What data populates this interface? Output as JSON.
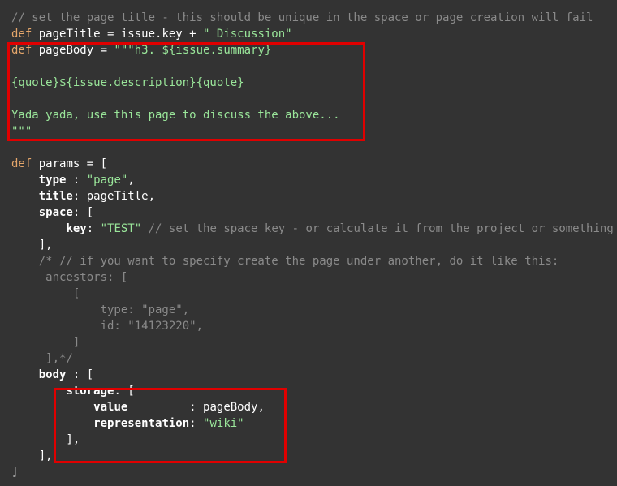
{
  "code_lines": [
    [
      {
        "t": "cmt",
        "s": "// set the page title - this should be unique in the space or page creation will fail"
      }
    ],
    [
      {
        "t": "kw",
        "s": "def"
      },
      {
        "t": "id",
        "s": " pageTitle = issue.key + "
      },
      {
        "t": "str",
        "s": "\" Discussion\""
      }
    ],
    [
      {
        "t": "kw",
        "s": "def"
      },
      {
        "t": "id",
        "s": " pageBody = "
      },
      {
        "t": "str",
        "s": "\"\"\"h3. ${issue.summary}"
      }
    ],
    [],
    [
      {
        "t": "str",
        "s": "{quote}${issue.description}{quote}"
      }
    ],
    [],
    [
      {
        "t": "str",
        "s": "Yada yada, use this page to discuss the above..."
      }
    ],
    [
      {
        "t": "str",
        "s": "\"\"\""
      }
    ],
    [],
    [
      {
        "t": "kw",
        "s": "def"
      },
      {
        "t": "id",
        "s": " params = ["
      }
    ],
    [
      {
        "t": "id",
        "s": "    "
      },
      {
        "t": "key",
        "s": "type"
      },
      {
        "t": "id",
        "s": " : "
      },
      {
        "t": "str",
        "s": "\"page\""
      },
      {
        "t": "id",
        "s": ","
      }
    ],
    [
      {
        "t": "id",
        "s": "    "
      },
      {
        "t": "key",
        "s": "title"
      },
      {
        "t": "id",
        "s": ": pageTitle,"
      }
    ],
    [
      {
        "t": "id",
        "s": "    "
      },
      {
        "t": "key",
        "s": "space"
      },
      {
        "t": "id",
        "s": ": ["
      }
    ],
    [
      {
        "t": "id",
        "s": "        "
      },
      {
        "t": "key",
        "s": "key"
      },
      {
        "t": "id",
        "s": ": "
      },
      {
        "t": "str",
        "s": "\"TEST\""
      },
      {
        "t": "cmt",
        "s": " // set the space key - or calculate it from the project or something"
      }
    ],
    [
      {
        "t": "id",
        "s": "    ],"
      }
    ],
    [
      {
        "t": "cmt",
        "s": "    /* // if you want to specify create the page under another, do it like this:"
      }
    ],
    [
      {
        "t": "cmt",
        "s": "     ancestors: ["
      }
    ],
    [
      {
        "t": "cmt",
        "s": "         ["
      }
    ],
    [
      {
        "t": "cmt",
        "s": "             type: \"page\","
      }
    ],
    [
      {
        "t": "cmt",
        "s": "             id: \"14123220\","
      }
    ],
    [
      {
        "t": "cmt",
        "s": "         ]"
      }
    ],
    [
      {
        "t": "cmt",
        "s": "     ],*/"
      }
    ],
    [
      {
        "t": "id",
        "s": "    "
      },
      {
        "t": "key",
        "s": "body"
      },
      {
        "t": "id",
        "s": " : ["
      }
    ],
    [
      {
        "t": "id",
        "s": "        "
      },
      {
        "t": "key",
        "s": "storage"
      },
      {
        "t": "id",
        "s": ": ["
      }
    ],
    [
      {
        "t": "id",
        "s": "            "
      },
      {
        "t": "key",
        "s": "value"
      },
      {
        "t": "id",
        "s": "         : pageBody,"
      }
    ],
    [
      {
        "t": "id",
        "s": "            "
      },
      {
        "t": "key",
        "s": "representation"
      },
      {
        "t": "id",
        "s": ": "
      },
      {
        "t": "str",
        "s": "\"wiki\""
      }
    ],
    [
      {
        "t": "id",
        "s": "        ],"
      }
    ],
    [
      {
        "t": "id",
        "s": "    ],"
      }
    ],
    [
      {
        "t": "id",
        "s": "]"
      }
    ]
  ],
  "colors": {
    "background": "#333333",
    "keyword": "#e6a76b",
    "string": "#9ae69a",
    "comment": "#8a8a8a",
    "highlight": "#e00000"
  }
}
